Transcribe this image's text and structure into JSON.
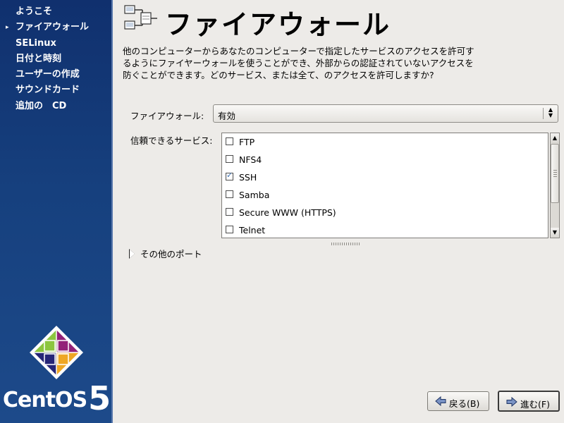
{
  "sidebar": {
    "items": [
      {
        "label": "ようこそ",
        "current": false
      },
      {
        "label": "ファイアウォール",
        "current": true
      },
      {
        "label": "SELinux",
        "current": false
      },
      {
        "label": "日付と時刻",
        "current": false
      },
      {
        "label": "ユーザーの作成",
        "current": false
      },
      {
        "label": "サウンドカード",
        "current": false
      },
      {
        "label": "追加の　CD",
        "current": false
      }
    ],
    "current_marker": "▸",
    "brand_word": "CentOS",
    "brand_number": "5"
  },
  "page": {
    "title": "ファイアウォール",
    "description": "他のコンピューターからあなたのコンピューターで指定したサービスのアクセスを許可するようにファイヤーウォールを使うことができ、外部からの認証されていないアクセスを防ぐことができます。どのサービス、または全て、のアクセスを許可しますか?"
  },
  "firewall": {
    "label": "ファイアウォール:",
    "value": "有効"
  },
  "services": {
    "label": "信頼できるサービス:",
    "items": [
      {
        "label": "FTP",
        "checked": false
      },
      {
        "label": "NFS4",
        "checked": false
      },
      {
        "label": "SSH",
        "checked": true
      },
      {
        "label": "Samba",
        "checked": false
      },
      {
        "label": "Secure WWW (HTTPS)",
        "checked": false
      },
      {
        "label": "Telnet",
        "checked": false
      }
    ],
    "check_glyph": "✓"
  },
  "other_ports": {
    "label": "その他のポート"
  },
  "buttons": {
    "back": "戻る(B)",
    "next": "進む(F)"
  },
  "colors": {
    "sidebar": "#16407e",
    "background": "#edebe8",
    "logo_green": "#8cc63f",
    "logo_purple": "#932279",
    "logo_blue": "#262577",
    "logo_orange": "#efa724"
  }
}
